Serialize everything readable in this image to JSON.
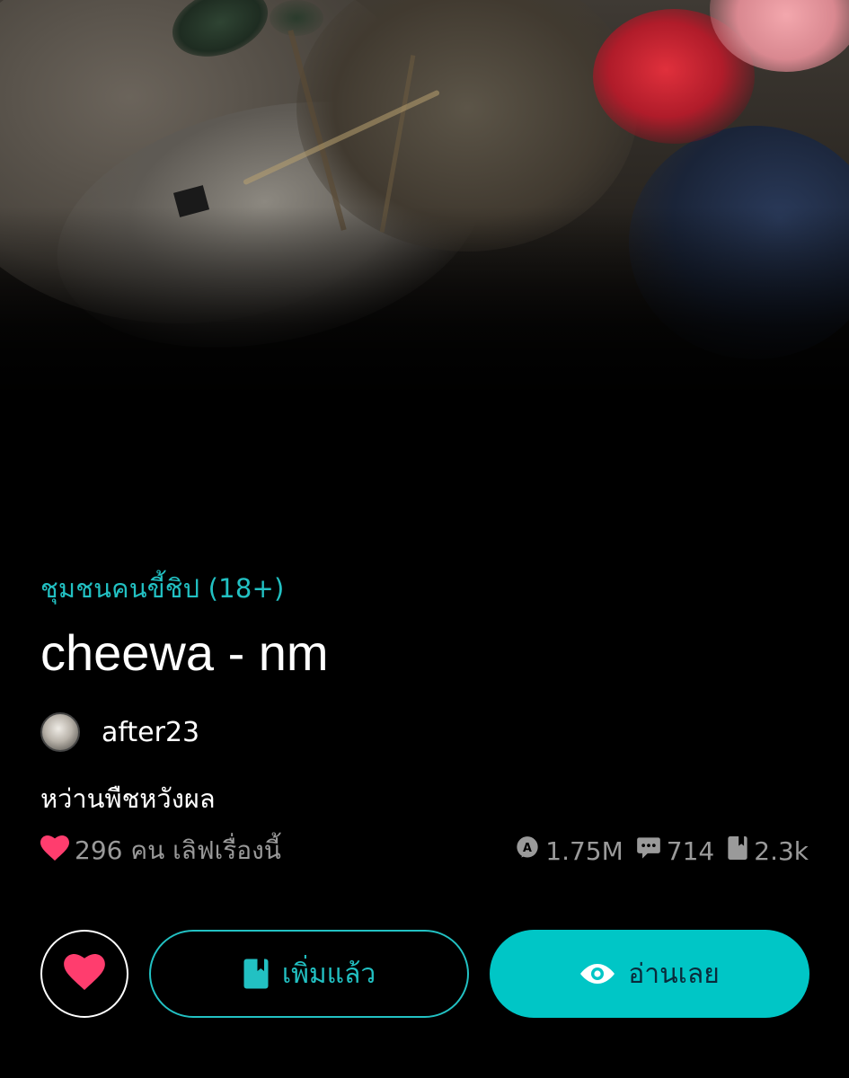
{
  "story": {
    "category": "ชุมชนคนขี้ชิป  (18+)",
    "title": "cheewa - nm",
    "author": "after23",
    "tagline": "หว่านพืชหวังผล"
  },
  "stats": {
    "love_text": "296 คน เลิฟเรื่องนี้",
    "reads": "1.75M",
    "comments": "714",
    "bookmarks": "2.3k"
  },
  "actions": {
    "added_label": "เพิ่มแล้ว",
    "read_label": "อ่านเลย"
  },
  "colors": {
    "accent": "#22c1c3",
    "read_button_bg": "#00c6c6",
    "heart": "#ff3d6e",
    "muted": "#9a9a9a",
    "background": "#000000"
  },
  "icons": [
    "heart-icon",
    "reads-icon",
    "comment-icon",
    "bookmark-icon",
    "eye-icon"
  ]
}
